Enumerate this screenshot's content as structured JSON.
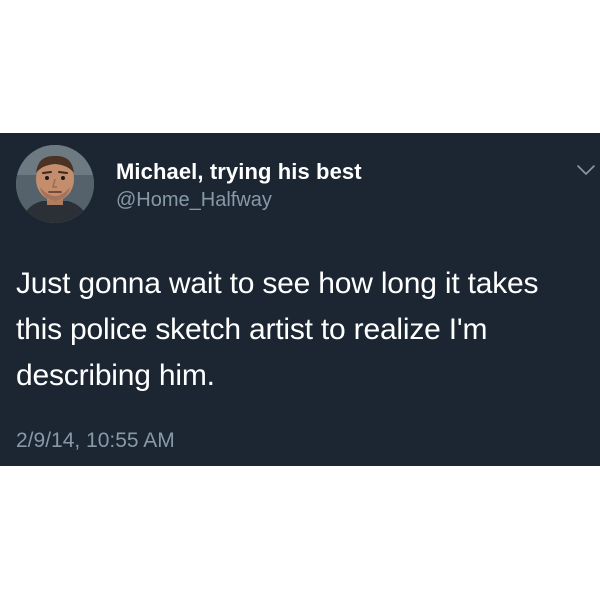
{
  "tweet": {
    "display_name": "Michael, trying his best",
    "handle": "@Home_Halfway",
    "text_lines": [
      "Just gonna wait to see how long it takes",
      "this police sketch artist to realize I'm",
      "describing him."
    ],
    "timestamp": "2/9/14, 10:55 AM",
    "menu_icon": "chevron-down-icon",
    "avatar_icon": "profile-photo"
  },
  "colors": {
    "card_background": "#1b2632",
    "primary_text": "#ffffff",
    "secondary_text": "#8899a6",
    "page_background": "#ffffff"
  }
}
